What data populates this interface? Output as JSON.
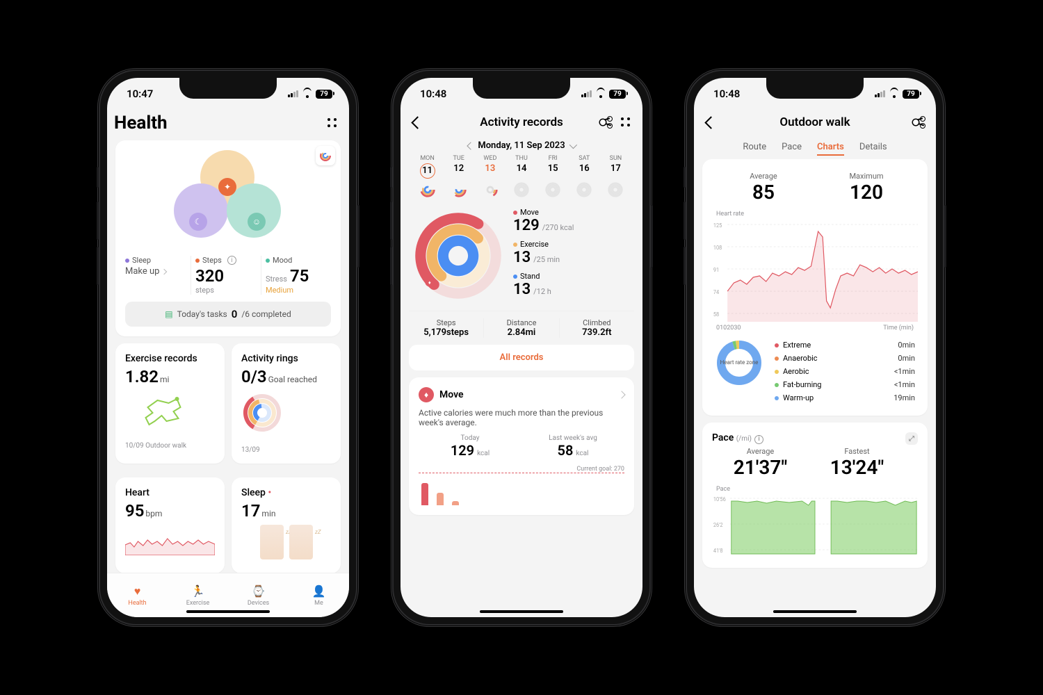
{
  "status": {
    "time1": "10:47",
    "time2": "10:48",
    "time3": "10:48",
    "battery": "79"
  },
  "s1": {
    "title": "Health",
    "petals": {
      "m1": "Sleep",
      "m2": "Steps",
      "m3": "Mood",
      "v1_label": "Make up",
      "v2": "320",
      "v2_unit": "steps",
      "v3_label": "Stress",
      "v3": "75",
      "v3_tag": "Medium"
    },
    "tasks": {
      "pre": "Today's tasks",
      "done": "0",
      "total": "/6 completed"
    },
    "ex": {
      "title": "Exercise records",
      "val": "1.82",
      "unit": "mi",
      "cap": "10/09 Outdoor walk"
    },
    "ring": {
      "title": "Activity rings",
      "val": "0/3",
      "unit": "Goal reached",
      "cap": "13/09"
    },
    "heart": {
      "title": "Heart",
      "val": "95",
      "unit": "bpm"
    },
    "sleep": {
      "title": "Sleep",
      "val": "17",
      "unit": "min"
    },
    "tabs": [
      "Health",
      "Exercise",
      "Devices",
      "Me"
    ]
  },
  "s2": {
    "title": "Activity records",
    "date": "Monday, 11 Sep 2023",
    "days": [
      "MON",
      "TUE",
      "WED",
      "THU",
      "FRI",
      "SAT",
      "SUN"
    ],
    "nums": [
      "11",
      "12",
      "13",
      "14",
      "15",
      "16",
      "17"
    ],
    "move": {
      "lab": "Move",
      "v": "129",
      "t": "/270 kcal"
    },
    "exercise": {
      "lab": "Exercise",
      "v": "13",
      "t": "/25 min"
    },
    "stand": {
      "lab": "Stand",
      "v": "13",
      "t": "/12 h"
    },
    "steps": {
      "l": "Steps",
      "v": "5,179steps"
    },
    "distance": {
      "l": "Distance",
      "v": "2.84mi"
    },
    "climbed": {
      "l": "Climbed",
      "v": "739.2ft"
    },
    "allrec": "All records",
    "moveCard": {
      "title": "Move",
      "text": "Active calories were much more than the previous week's average.",
      "today_l": "Today",
      "today_v": "129",
      "today_u": "kcal",
      "avg_l": "Last week's avg",
      "avg_v": "58",
      "avg_u": "kcal",
      "goal": "Current goal: 270"
    }
  },
  "s3": {
    "title": "Outdoor walk",
    "tabs": [
      "Route",
      "Pace",
      "Charts",
      "Details"
    ],
    "hr": {
      "avg_l": "Average",
      "avg_v": "85",
      "max_l": "Maximum",
      "max_v": "120",
      "label": "Heart rate",
      "yticks": [
        "125",
        "108",
        "91",
        "74",
        "58"
      ],
      "xticks": [
        "0",
        "10",
        "20",
        "30"
      ],
      "xunit": "Time (min)"
    },
    "zone": {
      "center": "Heart rate zone",
      "rows": [
        {
          "c": "#e05963",
          "l": "Extreme",
          "v": "0min"
        },
        {
          "c": "#ed8b52",
          "l": "Anaerobic",
          "v": "0min"
        },
        {
          "c": "#efc95a",
          "l": "Aerobic",
          "v": "<1min"
        },
        {
          "c": "#76c971",
          "l": "Fat-burning",
          "v": "<1min"
        },
        {
          "c": "#6fa8ef",
          "l": "Warm-up",
          "v": "19min"
        }
      ]
    },
    "pace": {
      "title": "Pace",
      "unit": "(/mi)",
      "avg_l": "Average",
      "avg_v": "21'37\"",
      "fast_l": "Fastest",
      "fast_v": "13'24\"",
      "label": "Pace",
      "yticks": [
        "10'56",
        "26'2",
        "41'8"
      ]
    }
  },
  "chart_data": [
    {
      "type": "line",
      "title": "Heart rate",
      "xlabel": "Time (min)",
      "ylabel": "Heart rate (bpm)",
      "xlim": [
        0,
        38
      ],
      "ylim": [
        58,
        125
      ],
      "x": [
        0,
        2,
        4,
        6,
        8,
        10,
        12,
        14,
        16,
        18,
        19.5,
        20,
        21,
        22,
        23,
        24,
        25,
        26,
        28,
        30,
        32,
        34,
        36,
        38
      ],
      "values": [
        74,
        80,
        82,
        80,
        85,
        86,
        82,
        88,
        86,
        90,
        118,
        112,
        72,
        66,
        76,
        86,
        88,
        86,
        92,
        90,
        86,
        88,
        86,
        88
      ]
    },
    {
      "type": "bar",
      "title": "Move — daily active calories",
      "categories": [
        "MON",
        "TUE",
        "WED",
        "THU",
        "FRI",
        "SAT",
        "SUN"
      ],
      "values": [
        129,
        70,
        25,
        null,
        null,
        null,
        null
      ],
      "ylabel": "kcal",
      "annotations": [
        {
          "text": "Current goal: 270",
          "y": 270
        }
      ]
    },
    {
      "type": "area",
      "title": "Pace (/mi)",
      "xlabel": "Time (min)",
      "ylabel": "Pace (min/mi, lower=faster)",
      "ylim": [
        10.9,
        41.8
      ],
      "y_inverted": true,
      "xlim": [
        0,
        38
      ],
      "series": [
        {
          "name": "segment1",
          "x": [
            0,
            2,
            4,
            6,
            8,
            10,
            12,
            14,
            16,
            18
          ],
          "values": [
            12,
            12,
            12,
            13,
            12,
            12,
            12,
            12,
            15,
            12
          ]
        },
        {
          "name": "segment2",
          "x": [
            22,
            24,
            26,
            28,
            30,
            32,
            34,
            36,
            38
          ],
          "values": [
            12,
            12,
            12,
            12,
            12,
            12,
            13,
            12,
            12
          ]
        }
      ]
    },
    {
      "type": "pie",
      "title": "Heart rate zone",
      "categories": [
        "Extreme",
        "Anaerobic",
        "Aerobic",
        "Fat-burning",
        "Warm-up"
      ],
      "values": [
        0,
        0,
        0.5,
        0.5,
        19
      ],
      "unit": "min"
    }
  ]
}
